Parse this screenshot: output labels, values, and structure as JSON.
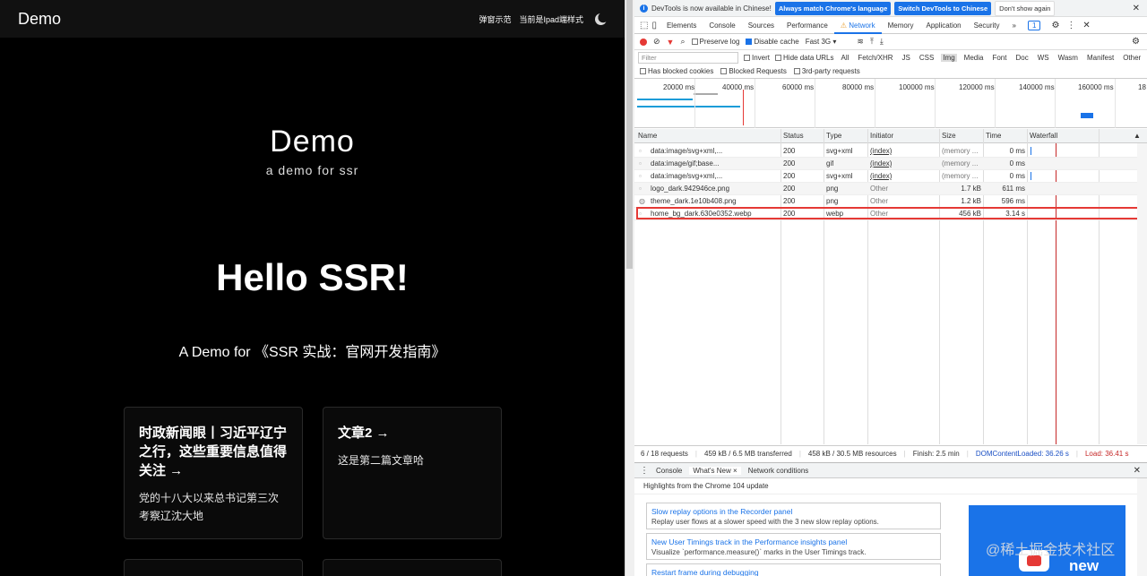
{
  "site": {
    "logo": "Demo",
    "nav": {
      "popup_demo": "弹窗示范",
      "ipad_style": "当前是Ipad端样式"
    },
    "hero": {
      "title": "Demo",
      "subtitle": "a demo for ssr",
      "headline": "Hello SSR!",
      "tagline": "A Demo for 《SSR 实战：官网开发指南》"
    },
    "cards": [
      {
        "title": "时政新闻眼丨习近平辽宁之行，这些重要信息值得关注 →",
        "body": "党的十八大以来总书记第三次考察辽沈大地"
      },
      {
        "title": "文章2 →",
        "body": "这是第二篇文章哈"
      }
    ]
  },
  "devtools": {
    "infobar": {
      "message": "DevTools is now available in Chinese!",
      "btn_match": "Always match Chrome's language",
      "btn_switch": "Switch DevTools to Chinese",
      "btn_dismiss": "Don't show again"
    },
    "tabs": [
      "Elements",
      "Console",
      "Sources",
      "Performance",
      "Network",
      "Memory",
      "Application",
      "Security"
    ],
    "active_tab": "Network",
    "more_tabs": "»",
    "issues_badge": "1",
    "toolbar": {
      "preserve_log": "Preserve log",
      "disable_cache": "Disable cache",
      "throttle": "Fast 3G"
    },
    "filter": {
      "placeholder": "Filter",
      "invert": "Invert",
      "hide_data_urls": "Hide data URLs",
      "types": [
        "All",
        "Fetch/XHR",
        "JS",
        "CSS",
        "Img",
        "Media",
        "Font",
        "Doc",
        "WS",
        "Wasm",
        "Manifest",
        "Other"
      ],
      "active_type": "Img"
    },
    "checkboxes": {
      "blocked_cookies": "Has blocked cookies",
      "blocked_requests": "Blocked Requests",
      "third_party": "3rd-party requests"
    },
    "timeline_ticks": [
      "20000 ms",
      "40000 ms",
      "60000 ms",
      "80000 ms",
      "100000 ms",
      "120000 ms",
      "140000 ms",
      "160000 ms",
      "18"
    ],
    "columns": {
      "name": "Name",
      "status": "Status",
      "type": "Type",
      "initiator": "Initiator",
      "size": "Size",
      "time": "Time",
      "waterfall": "Waterfall"
    },
    "requests": [
      {
        "name": "data:image/svg+xml,...",
        "status": "200",
        "type": "svg+xml",
        "initiator": "(index)",
        "size": "(memory ...",
        "time": "0 ms"
      },
      {
        "name": "data:image/gif;base...",
        "status": "200",
        "type": "gif",
        "initiator": "(index)",
        "size": "(memory ...",
        "time": "0 ms"
      },
      {
        "name": "data:image/svg+xml,...",
        "status": "200",
        "type": "svg+xml",
        "initiator": "(index)",
        "size": "(memory ...",
        "time": "0 ms"
      },
      {
        "name": "logo_dark.942946ce.png",
        "status": "200",
        "type": "png",
        "initiator": "Other",
        "size": "1.7 kB",
        "time": "611 ms"
      },
      {
        "name": "theme_dark.1e10b408.png",
        "status": "200",
        "type": "png",
        "initiator": "Other",
        "size": "1.2 kB",
        "time": "596 ms"
      },
      {
        "name": "home_bg_dark.630e0352.webp",
        "status": "200",
        "type": "webp",
        "initiator": "Other",
        "size": "456 kB",
        "time": "3.14 s"
      }
    ],
    "status": {
      "requests": "6 / 18 requests",
      "transferred": "459 kB / 6.5 MB transferred",
      "resources": "458 kB / 30.5 MB resources",
      "finish": "Finish: 2.5 min",
      "dcl": "DOMContentLoaded: 36.26 s",
      "load": "Load: 36.41 s"
    },
    "drawer": {
      "tabs": [
        "Console",
        "What's New",
        "Network conditions"
      ],
      "active": "What's New",
      "close": "×",
      "highlight": "Highlights from the Chrome 104 update"
    },
    "news": [
      {
        "title": "Slow replay options in the Recorder panel",
        "desc": "Replay user flows at a slower speed with the 3 new slow replay options."
      },
      {
        "title": "New User Timings track in the Performance insights panel",
        "desc": "Visualize `performance.measure()` marks in the User Timings track."
      },
      {
        "title": "Restart frame during debugging",
        "desc": ""
      }
    ],
    "promo_text": "new",
    "watermark": "@稀土掘金技术社区"
  }
}
